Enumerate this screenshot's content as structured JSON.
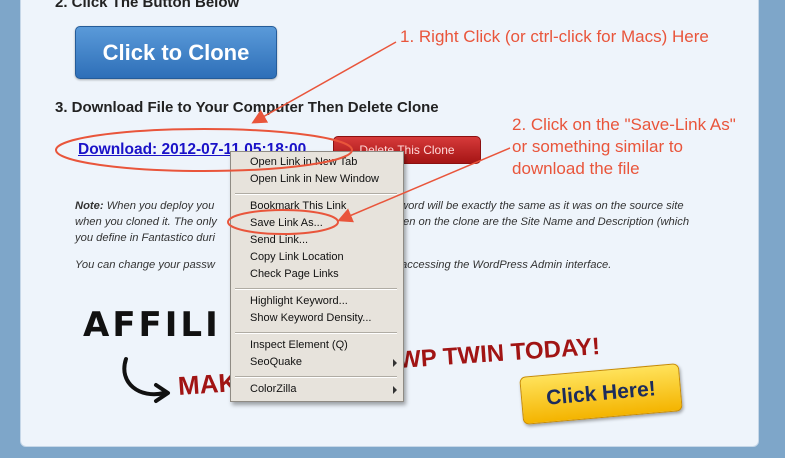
{
  "steps": {
    "step2": "2.  Click The Button Below",
    "step3": "3.  Download File to Your Computer Then Delete Clone"
  },
  "buttons": {
    "clone": "Click to Clone",
    "delete": "Delete This Clone",
    "click_here": "Click Here!"
  },
  "download_link": "Download: 2012-07-11 05:18:00",
  "note": {
    "line1_label": "Note:",
    "line1": " When you deploy you",
    "line1_right": "word will be exactly the same as it was on the source site",
    "line2": "when you cloned it. The only",
    "line2_right": "en on the clone are the Site Name and Description (which",
    "line3": "you define in Fantastico duri",
    "para2_left": "You can change your passw",
    "para2_right": "accessing the WordPress Admin interface."
  },
  "banner": {
    "affil": "AFFILI",
    "make": "MAK",
    "wp_twin": "WP TWIN TODAY!"
  },
  "annotations": {
    "a1": "1. Right Click (or ctrl-click for Macs) Here",
    "a2_line1": "2. Click on the \"Save-Link As\"",
    "a2_line2": "or something similar to",
    "a2_line3": "download the file"
  },
  "context_menu": {
    "items": [
      "Open Link in New Tab",
      "Open Link in New Window",
      "Bookmark This Link",
      "Save Link As...",
      "Send Link...",
      "Copy Link Location",
      "Check Page Links",
      "Highlight Keyword...",
      "Show Keyword Density...",
      "Inspect Element (Q)",
      "SeoQuake",
      "ColorZilla"
    ]
  },
  "colors": {
    "annotation": "#e9553b",
    "link": "#1a12c8"
  }
}
